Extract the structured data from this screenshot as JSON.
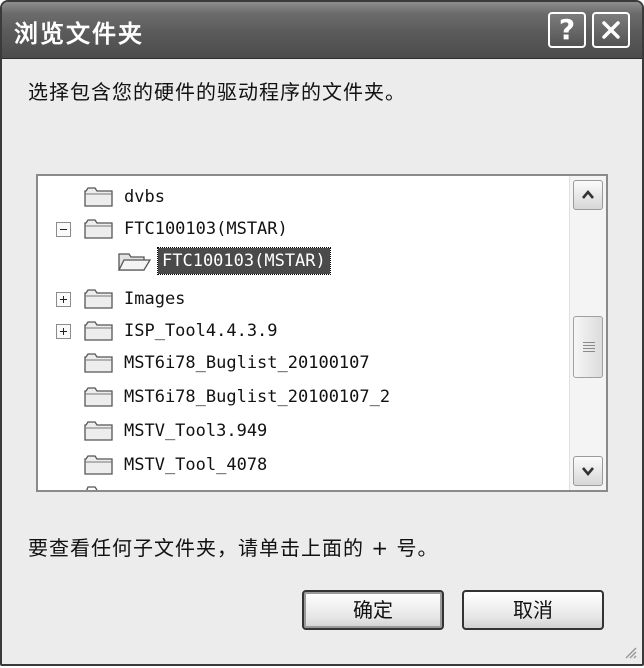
{
  "window": {
    "title": "浏览文件夹"
  },
  "titlebar": {
    "help_label": "?",
    "close_icon": "close-icon"
  },
  "instruction": "选择包含您的硬件的驱动程序的文件夹。",
  "tree": {
    "items": [
      {
        "label": "dvbs",
        "expander": "none",
        "selected": false
      },
      {
        "label": "FTC100103(MSTAR)",
        "expander": "collapse",
        "selected": false
      },
      {
        "label": "FTC100103(MSTAR)",
        "expander": "none",
        "selected": true
      },
      {
        "label": "Images",
        "expander": "expand",
        "selected": false
      },
      {
        "label": "ISP_Tool4.4.3.9",
        "expander": "expand",
        "selected": false
      },
      {
        "label": "MST6i78_Buglist_20100107",
        "expander": "none",
        "selected": false
      },
      {
        "label": "MST6i78_Buglist_20100107_2",
        "expander": "none",
        "selected": false
      },
      {
        "label": "MSTV_Tool3.949",
        "expander": "none",
        "selected": false
      },
      {
        "label": "MSTV_Tool_4078",
        "expander": "none",
        "selected": false
      }
    ]
  },
  "hint": "要查看任何子文件夹，请单击上面的 + 号。",
  "buttons": {
    "ok": "确定",
    "cancel": "取消"
  }
}
